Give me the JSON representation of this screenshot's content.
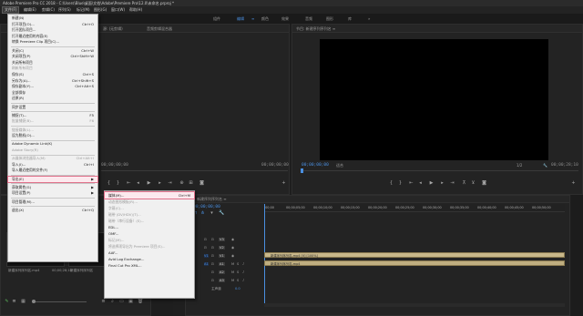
{
  "window": {
    "title": "Adobe Premiere Pro CC 2018 - C:\\Users\\Blue\\桌面\\文档\\Adobe\\Premiere Pro\\12.0\\未命名.prproj *"
  },
  "menubar": {
    "items": [
      "文件(F)",
      "编辑(E)",
      "剪辑(C)",
      "序列(S)",
      "标记(M)",
      "图形(G)",
      "窗口(W)",
      "帮助(H)"
    ]
  },
  "workspaces": {
    "tabs": [
      "组件",
      "编辑",
      "颜色",
      "效果",
      "音频",
      "图形",
      "库"
    ],
    "active": "编辑",
    "more": "»"
  },
  "source_panel": {
    "tabs": [
      "源: (无剪辑)",
      "效果控件",
      "音频剪辑混合器"
    ],
    "timecode_left": "00;00;00;00",
    "timecode_right": "00;00;00;00"
  },
  "program_panel": {
    "title": "节目: 新建序列序列名 ≡",
    "timecode_left": "00;00;00;00",
    "fit_label": "适合",
    "zoom": "1/2",
    "timecode_right": "00;00;28;10"
  },
  "timeline_panel": {
    "title": "新建序列序列名 ≡",
    "timecode": "00;00;00;00",
    "ruler_labels": [
      ":00;00",
      "00;00;05;00",
      "00;00;10;00",
      "00;00;15;00",
      "00;00;20;00",
      "00;00;25;00",
      "00;00;30;00",
      "00;00;35;00",
      "00;00;40;00",
      "00;00;45;00",
      "00;00;50;00"
    ],
    "tracks": [
      {
        "id": "V3",
        "label": "V3"
      },
      {
        "id": "V2",
        "label": "V2"
      },
      {
        "id": "V1",
        "label": "V1"
      },
      {
        "id": "A1",
        "label": "A1"
      },
      {
        "id": "A2",
        "label": "A2"
      },
      {
        "id": "A3",
        "label": "A3"
      }
    ],
    "master_label": "主声道",
    "master_value": "0.0",
    "video_clip_label": "新建序列序列名.mp4 [V] [100%]",
    "audio_clip_label": "新建序列序列名.mp4"
  },
  "project_panel": {
    "thumb1_label": "新建序列序列名.mp4",
    "thumb1_duration": "00;00;28;10",
    "thumb2_label": "新建序列序列名",
    "thumb2_duration": "28;10"
  },
  "file_menu": {
    "items": [
      {
        "label": "新建(N)",
        "shortcut": "",
        "disabled": false
      },
      {
        "label": "打开项目(O)...",
        "shortcut": "Ctrl+O",
        "disabled": false
      },
      {
        "label": "打开团队项目...",
        "shortcut": "",
        "disabled": false
      },
      {
        "label": "打开最近使用的内容(E)",
        "shortcut": "",
        "disabled": false
      },
      {
        "label": "转换 Premiere Clip 项目(C)...",
        "shortcut": "",
        "disabled": false
      },
      {
        "sep": true
      },
      {
        "label": "关闭(C)",
        "shortcut": "Ctrl+W",
        "disabled": false
      },
      {
        "label": "关闭项目(P)",
        "shortcut": "Ctrl+Shift+W",
        "disabled": false
      },
      {
        "label": "关闭所有项目",
        "shortcut": "",
        "disabled": false
      },
      {
        "label": "刷新所有项目",
        "shortcut": "",
        "disabled": true
      },
      {
        "label": "保存(S)",
        "shortcut": "Ctrl+S",
        "disabled": false
      },
      {
        "label": "另存为(A)...",
        "shortcut": "Ctrl+Shift+S",
        "disabled": false
      },
      {
        "label": "保存副本(Y)...",
        "shortcut": "Ctrl+Alt+S",
        "disabled": false
      },
      {
        "label": "全部保存",
        "shortcut": "",
        "disabled": false
      },
      {
        "label": "还原(R)",
        "shortcut": "",
        "disabled": false
      },
      {
        "sep": true
      },
      {
        "label": "同步设置",
        "shortcut": "",
        "disabled": false
      },
      {
        "sep": true
      },
      {
        "label": "捕捉(T)...",
        "shortcut": "F5",
        "disabled": false
      },
      {
        "label": "批量捕捉(B)...",
        "shortcut": "F6",
        "disabled": true
      },
      {
        "sep": true
      },
      {
        "label": "链接媒体(L)...",
        "shortcut": "",
        "disabled": true
      },
      {
        "label": "设为脱机(O)...",
        "shortcut": "",
        "disabled": false
      },
      {
        "sep": true
      },
      {
        "label": "Adobe Dynamic Link(K)",
        "shortcut": "",
        "disabled": false
      },
      {
        "label": "Adobe Story(R)",
        "shortcut": "",
        "disabled": true
      },
      {
        "sep": true
      },
      {
        "label": "从媒体浏览器导入(M)",
        "shortcut": "Ctrl+Alt+I",
        "disabled": true
      },
      {
        "label": "导入(I)...",
        "shortcut": "Ctrl+I",
        "disabled": false
      },
      {
        "label": "导入最近使用的文件(F)",
        "shortcut": "",
        "disabled": false
      },
      {
        "sep": true
      },
      {
        "label": "导出(E)",
        "shortcut": "",
        "disabled": false,
        "highlight": true
      },
      {
        "sep": true
      },
      {
        "label": "获取属性(G)",
        "shortcut": "",
        "disabled": false
      },
      {
        "label": "项目设置(P)",
        "shortcut": "",
        "disabled": false
      },
      {
        "sep": true
      },
      {
        "label": "项目管理(M)...",
        "shortcut": "",
        "disabled": false
      },
      {
        "sep": true
      },
      {
        "label": "退出(X)",
        "shortcut": "Ctrl+Q",
        "disabled": false
      }
    ]
  },
  "export_menu": {
    "items": [
      {
        "label": "媒体(M)...",
        "shortcut": "Ctrl+M",
        "disabled": false,
        "highlight": true
      },
      {
        "label": "动态图形模板(R)...",
        "shortcut": "",
        "disabled": true
      },
      {
        "label": "字幕(C)...",
        "shortcut": "",
        "disabled": true
      },
      {
        "label": "磁带 (DV/HDV)(T)...",
        "shortcut": "",
        "disabled": true
      },
      {
        "label": "磁带（串行设备）(S)...",
        "shortcut": "",
        "disabled": true
      },
      {
        "label": "EDL...",
        "shortcut": "",
        "disabled": false
      },
      {
        "label": "OMF...",
        "shortcut": "",
        "disabled": false
      },
      {
        "label": "标记(M)...",
        "shortcut": "",
        "disabled": true
      },
      {
        "label": "将选择项导出为 Premiere 项目(S)...",
        "shortcut": "",
        "disabled": true
      },
      {
        "label": "AAF...",
        "shortcut": "",
        "disabled": false
      },
      {
        "label": "Avid Log Exchange...",
        "shortcut": "",
        "disabled": false
      },
      {
        "label": "Final Cut Pro XML...",
        "shortcut": "",
        "disabled": false
      }
    ]
  },
  "colors": {
    "accent_blue": "#4a8fe0",
    "clip_video": "#c9b88a",
    "clip_audio": "#bfae80",
    "playhead": "#4a8fe0",
    "highlight_border": "#e0404a"
  }
}
